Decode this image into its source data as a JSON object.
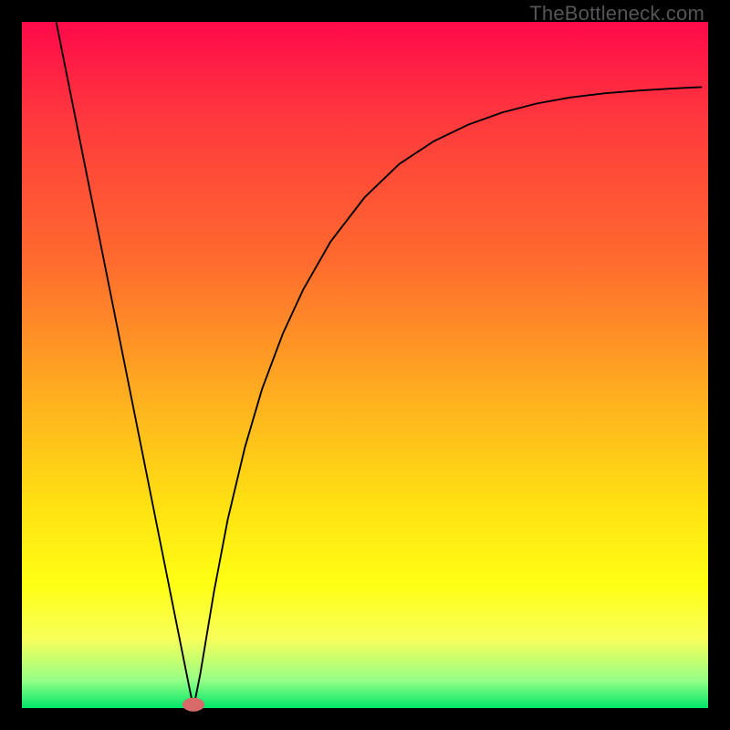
{
  "watermark": "TheBottleneck.com",
  "chart_data": {
    "type": "line",
    "title": "",
    "xlabel": "",
    "ylabel": "",
    "xlim": [
      0,
      100
    ],
    "ylim": [
      0,
      100
    ],
    "gradient_stops": [
      {
        "offset": 0.0,
        "color": "#ff0a4a"
      },
      {
        "offset": 0.15,
        "color": "#ff3b3d"
      },
      {
        "offset": 0.35,
        "color": "#ff6b2e"
      },
      {
        "offset": 0.55,
        "color": "#ffb01f"
      },
      {
        "offset": 0.7,
        "color": "#ffe012"
      },
      {
        "offset": 0.82,
        "color": "#ffff14"
      },
      {
        "offset": 0.9,
        "color": "#f7ff5a"
      },
      {
        "offset": 0.96,
        "color": "#94ff86"
      },
      {
        "offset": 1.0,
        "color": "#00e66a"
      }
    ],
    "series": [
      {
        "name": "bottleneck-curve",
        "x": [
          5.0,
          7.5,
          10.0,
          12.5,
          15.0,
          17.5,
          20.0,
          21.5,
          23.0,
          24.0,
          24.8,
          25.0,
          25.2,
          26.0,
          27.0,
          28.0,
          30.0,
          32.5,
          35.0,
          38.0,
          41.0,
          45.0,
          50.0,
          55.0,
          60.0,
          65.0,
          70.0,
          75.0,
          80.0,
          85.0,
          90.0,
          95.0,
          99.0
        ],
        "y": [
          100.0,
          87.5,
          75.0,
          62.5,
          50.0,
          37.5,
          25.0,
          17.5,
          10.0,
          5.0,
          1.0,
          0.0,
          1.0,
          5.0,
          11.0,
          17.0,
          27.5,
          38.0,
          46.5,
          54.5,
          61.0,
          68.0,
          74.5,
          79.3,
          82.6,
          85.0,
          86.8,
          88.1,
          89.0,
          89.6,
          90.0,
          90.3,
          90.5
        ]
      }
    ],
    "marker": {
      "x": 25.0,
      "y": 0.5,
      "rx": 1.6,
      "ry": 1.0,
      "color": "#d86a6a"
    }
  }
}
